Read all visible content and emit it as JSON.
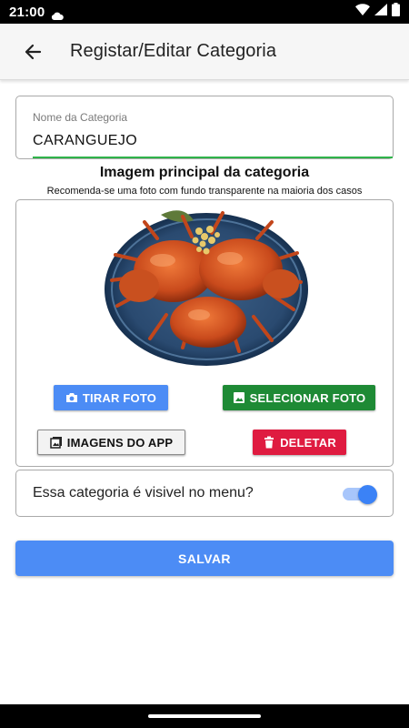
{
  "status_bar": {
    "time": "21:00",
    "icons": [
      "cloud-icon",
      "wifi-icon",
      "signal-icon",
      "battery-icon"
    ]
  },
  "app_bar": {
    "back_icon": "arrow-left-icon",
    "title": "Registar/Editar Categoria"
  },
  "category_name": {
    "label": "Nome da Categoria",
    "value": "CARANGUEJO",
    "focus_color": "#2fb34a"
  },
  "image_section": {
    "heading": "Imagem principal da categoria",
    "hint": "Recomenda-se uma foto com fundo transparente na maioria dos casos",
    "photo": "crab-dish-photo",
    "buttons": {
      "take_photo": "TIRAR FOTO",
      "select_photo": "SELECIONAR FOTO",
      "app_images": "IMAGENS DO APP",
      "delete": "DELETAR"
    }
  },
  "visibility": {
    "label": "Essa categoria é visivel no menu?",
    "enabled": true
  },
  "save_button": "SALVAR",
  "colors": {
    "primary": "#4c8cf5",
    "success": "#1e8a35",
    "danger": "#df1b40",
    "toggle_on": "#3b82f6"
  }
}
